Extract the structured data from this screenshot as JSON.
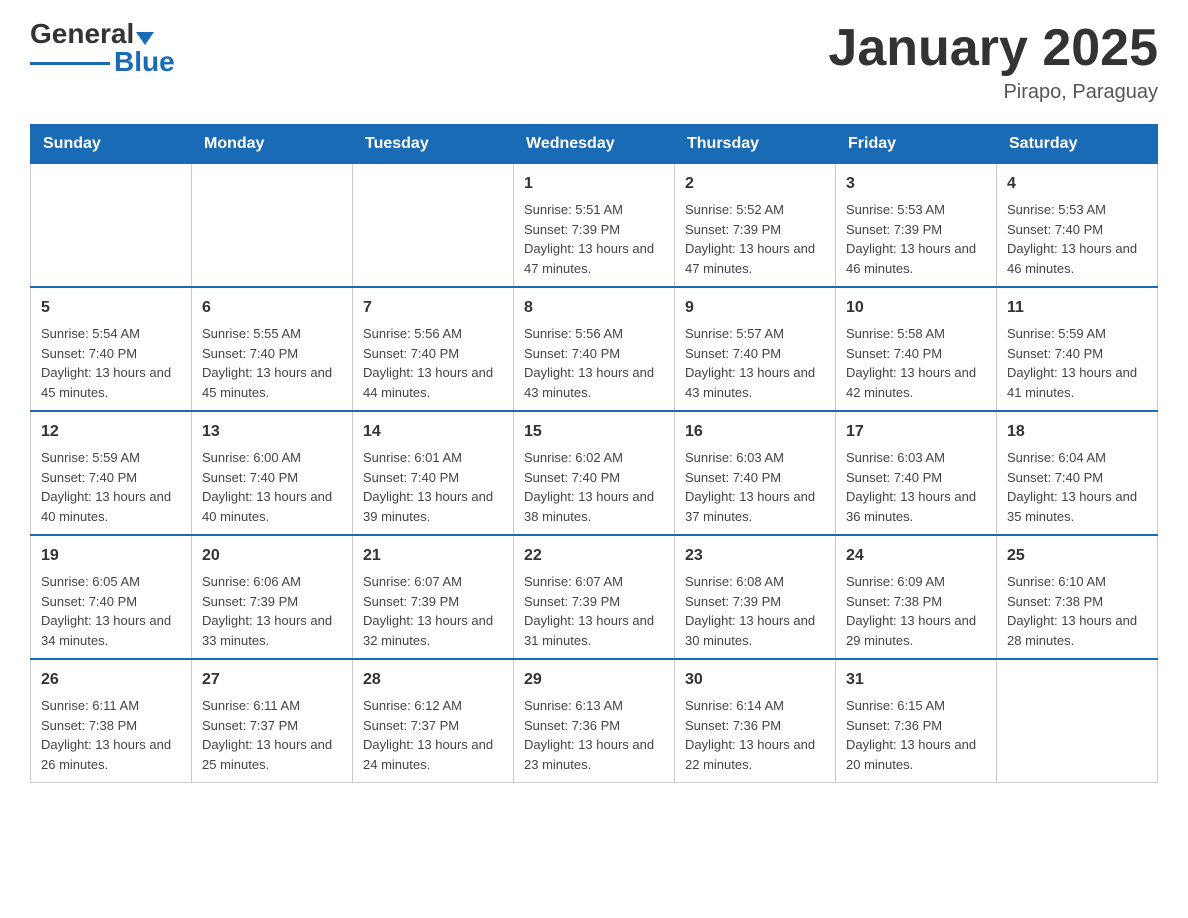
{
  "header": {
    "logo_text_black": "General",
    "logo_text_blue": "Blue",
    "month_title": "January 2025",
    "location": "Pirapo, Paraguay"
  },
  "days_of_week": [
    "Sunday",
    "Monday",
    "Tuesday",
    "Wednesday",
    "Thursday",
    "Friday",
    "Saturday"
  ],
  "weeks": [
    [
      {
        "day": "",
        "info": ""
      },
      {
        "day": "",
        "info": ""
      },
      {
        "day": "",
        "info": ""
      },
      {
        "day": "1",
        "info": "Sunrise: 5:51 AM\nSunset: 7:39 PM\nDaylight: 13 hours and 47 minutes."
      },
      {
        "day": "2",
        "info": "Sunrise: 5:52 AM\nSunset: 7:39 PM\nDaylight: 13 hours and 47 minutes."
      },
      {
        "day": "3",
        "info": "Sunrise: 5:53 AM\nSunset: 7:39 PM\nDaylight: 13 hours and 46 minutes."
      },
      {
        "day": "4",
        "info": "Sunrise: 5:53 AM\nSunset: 7:40 PM\nDaylight: 13 hours and 46 minutes."
      }
    ],
    [
      {
        "day": "5",
        "info": "Sunrise: 5:54 AM\nSunset: 7:40 PM\nDaylight: 13 hours and 45 minutes."
      },
      {
        "day": "6",
        "info": "Sunrise: 5:55 AM\nSunset: 7:40 PM\nDaylight: 13 hours and 45 minutes."
      },
      {
        "day": "7",
        "info": "Sunrise: 5:56 AM\nSunset: 7:40 PM\nDaylight: 13 hours and 44 minutes."
      },
      {
        "day": "8",
        "info": "Sunrise: 5:56 AM\nSunset: 7:40 PM\nDaylight: 13 hours and 43 minutes."
      },
      {
        "day": "9",
        "info": "Sunrise: 5:57 AM\nSunset: 7:40 PM\nDaylight: 13 hours and 43 minutes."
      },
      {
        "day": "10",
        "info": "Sunrise: 5:58 AM\nSunset: 7:40 PM\nDaylight: 13 hours and 42 minutes."
      },
      {
        "day": "11",
        "info": "Sunrise: 5:59 AM\nSunset: 7:40 PM\nDaylight: 13 hours and 41 minutes."
      }
    ],
    [
      {
        "day": "12",
        "info": "Sunrise: 5:59 AM\nSunset: 7:40 PM\nDaylight: 13 hours and 40 minutes."
      },
      {
        "day": "13",
        "info": "Sunrise: 6:00 AM\nSunset: 7:40 PM\nDaylight: 13 hours and 40 minutes."
      },
      {
        "day": "14",
        "info": "Sunrise: 6:01 AM\nSunset: 7:40 PM\nDaylight: 13 hours and 39 minutes."
      },
      {
        "day": "15",
        "info": "Sunrise: 6:02 AM\nSunset: 7:40 PM\nDaylight: 13 hours and 38 minutes."
      },
      {
        "day": "16",
        "info": "Sunrise: 6:03 AM\nSunset: 7:40 PM\nDaylight: 13 hours and 37 minutes."
      },
      {
        "day": "17",
        "info": "Sunrise: 6:03 AM\nSunset: 7:40 PM\nDaylight: 13 hours and 36 minutes."
      },
      {
        "day": "18",
        "info": "Sunrise: 6:04 AM\nSunset: 7:40 PM\nDaylight: 13 hours and 35 minutes."
      }
    ],
    [
      {
        "day": "19",
        "info": "Sunrise: 6:05 AM\nSunset: 7:40 PM\nDaylight: 13 hours and 34 minutes."
      },
      {
        "day": "20",
        "info": "Sunrise: 6:06 AM\nSunset: 7:39 PM\nDaylight: 13 hours and 33 minutes."
      },
      {
        "day": "21",
        "info": "Sunrise: 6:07 AM\nSunset: 7:39 PM\nDaylight: 13 hours and 32 minutes."
      },
      {
        "day": "22",
        "info": "Sunrise: 6:07 AM\nSunset: 7:39 PM\nDaylight: 13 hours and 31 minutes."
      },
      {
        "day": "23",
        "info": "Sunrise: 6:08 AM\nSunset: 7:39 PM\nDaylight: 13 hours and 30 minutes."
      },
      {
        "day": "24",
        "info": "Sunrise: 6:09 AM\nSunset: 7:38 PM\nDaylight: 13 hours and 29 minutes."
      },
      {
        "day": "25",
        "info": "Sunrise: 6:10 AM\nSunset: 7:38 PM\nDaylight: 13 hours and 28 minutes."
      }
    ],
    [
      {
        "day": "26",
        "info": "Sunrise: 6:11 AM\nSunset: 7:38 PM\nDaylight: 13 hours and 26 minutes."
      },
      {
        "day": "27",
        "info": "Sunrise: 6:11 AM\nSunset: 7:37 PM\nDaylight: 13 hours and 25 minutes."
      },
      {
        "day": "28",
        "info": "Sunrise: 6:12 AM\nSunset: 7:37 PM\nDaylight: 13 hours and 24 minutes."
      },
      {
        "day": "29",
        "info": "Sunrise: 6:13 AM\nSunset: 7:36 PM\nDaylight: 13 hours and 23 minutes."
      },
      {
        "day": "30",
        "info": "Sunrise: 6:14 AM\nSunset: 7:36 PM\nDaylight: 13 hours and 22 minutes."
      },
      {
        "day": "31",
        "info": "Sunrise: 6:15 AM\nSunset: 7:36 PM\nDaylight: 13 hours and 20 minutes."
      },
      {
        "day": "",
        "info": ""
      }
    ]
  ]
}
